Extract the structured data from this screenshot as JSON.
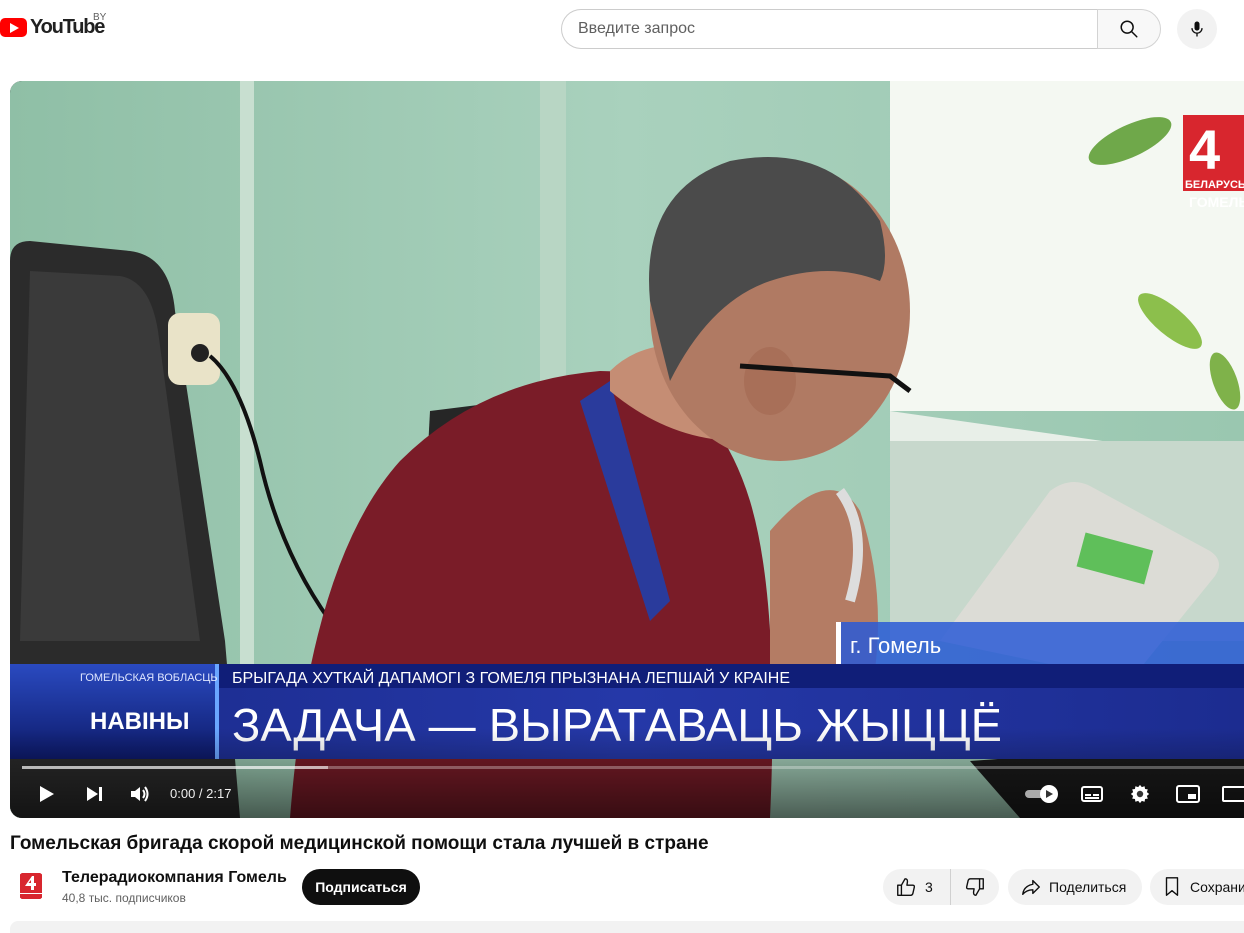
{
  "header": {
    "logo_text": "YouTube",
    "country_code": "BY",
    "search_placeholder": "Введите запрос"
  },
  "video": {
    "location_caption": "г. Гомель",
    "lower_third": {
      "region": "ГОМЕЛЬСКАЯ ВОБЛАСЦЬ",
      "show": "НАВІНЫ",
      "subtitle": "БРЫГАДА ХУТКАЙ ДАПАМОГІ З ГОМЕЛЯ ПРЫЗНАНА ЛЕПШАЙ У КРАІНЕ",
      "headline": "ЗАДАЧА — ВЫРАТАВАЦЬ ЖЫЦЦЁ"
    },
    "channel_bug": {
      "number": "4",
      "line1": "БЕЛАРУСЬ",
      "line2": "ГОМЕЛЬ"
    },
    "player": {
      "time": "0:00 / 2:17",
      "progress": 0,
      "buffered": 0.25
    }
  },
  "meta": {
    "title": "Гомельская бригада скорой медицинской помощи стала лучшей в стране",
    "channel_name": "Телерадиокомпания Гомель",
    "subscribers": "40,8 тыс. подписчиков",
    "subscribe_label": "Подписаться",
    "likes": "3",
    "share_label": "Поделиться",
    "save_label": "Сохрани"
  },
  "colors": {
    "brand_red": "#ff0000",
    "lower_third_blue": "#1e2a8c",
    "wall_green": "#9fc8b0"
  }
}
